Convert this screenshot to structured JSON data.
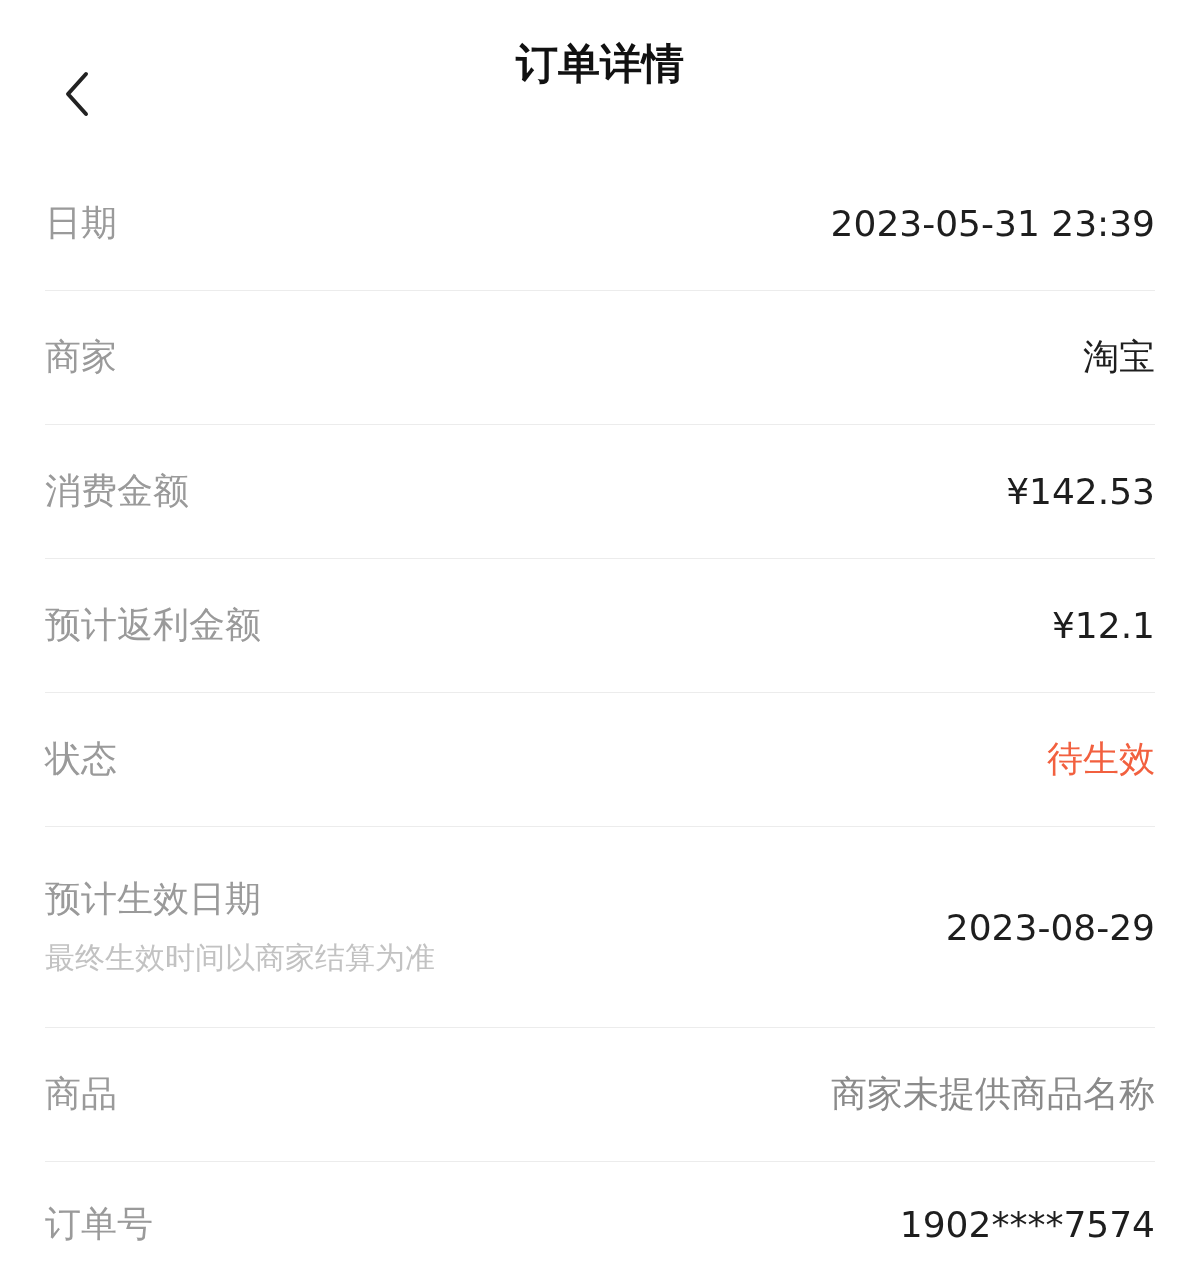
{
  "header": {
    "title": "订单详情"
  },
  "rows": [
    {
      "kind": "plain",
      "label": "日期",
      "value": "2023-05-31 23:39"
    },
    {
      "kind": "plain",
      "label": "商家",
      "value": "淘宝"
    },
    {
      "kind": "plain",
      "label": "消费金额",
      "value": "¥142.53"
    },
    {
      "kind": "plain",
      "label": "预计返利金额",
      "value": "¥12.1"
    },
    {
      "kind": "status",
      "label": "状态",
      "value": "待生效"
    },
    {
      "kind": "plain",
      "label": "预计生效日期",
      "note": "最终生效时间以商家结算为准",
      "value": "2023-08-29"
    },
    {
      "kind": "muted",
      "label": "商品",
      "value": "商家未提供商品名称"
    },
    {
      "kind": "plain",
      "label": "订单号",
      "value": "1902****7574"
    }
  ]
}
